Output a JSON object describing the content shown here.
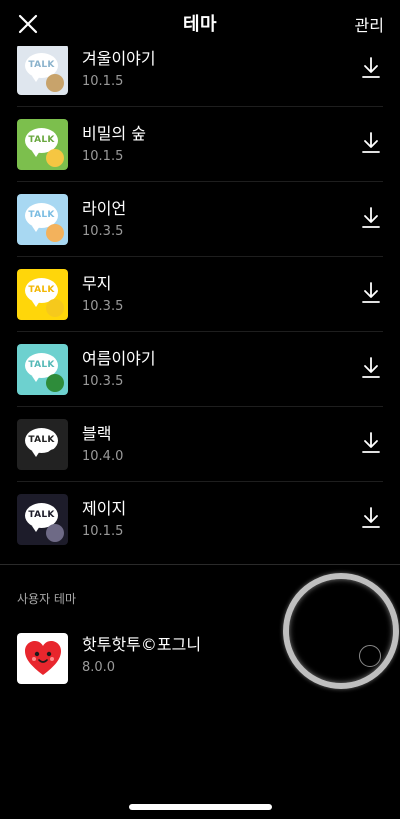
{
  "header": {
    "title": "테마",
    "manage_label": "관리",
    "close_icon": "close-icon"
  },
  "themes": [
    {
      "name": "겨울이야기",
      "version": "10.1.5",
      "thumb_bg": "#dfe6ee",
      "bubble_text": "TALK",
      "bubble_text_color": "#8bb3cc",
      "deco_color": "#c8a36b"
    },
    {
      "name": "비밀의 숲",
      "version": "10.1.5",
      "thumb_bg": "#7cbf4d",
      "bubble_text": "TALK",
      "bubble_text_color": "#6aa83f",
      "deco_color": "#f5c642"
    },
    {
      "name": "라이언",
      "version": "10.3.5",
      "thumb_bg": "#a8d8f2",
      "bubble_text": "TALK",
      "bubble_text_color": "#7cbde2",
      "deco_color": "#f3b25c"
    },
    {
      "name": "무지",
      "version": "10.3.5",
      "thumb_bg": "#ffd60a",
      "bubble_text": "TALK",
      "bubble_text_color": "#f2b705",
      "deco_color": "#f6c91c"
    },
    {
      "name": "여름이야기",
      "version": "10.3.5",
      "thumb_bg": "#6dd1cf",
      "bubble_text": "TALK",
      "bubble_text_color": "#55b9b7",
      "deco_color": "#2e8c3a"
    },
    {
      "name": "블랙",
      "version": "10.4.0",
      "thumb_bg": "#222222",
      "bubble_text": "TALK",
      "bubble_text_color": "#222222",
      "deco_color": "#222222"
    },
    {
      "name": "제이지",
      "version": "10.1.5",
      "thumb_bg": "#1d1c2a",
      "bubble_text": "TALK",
      "bubble_text_color": "#1d1c2a",
      "deco_color": "#6e6a86"
    }
  ],
  "user_section": {
    "title": "사용자 테마",
    "theme": {
      "name": "핫투핫투©포그니",
      "version": "8.0.0",
      "heart_color": "#e8262d"
    }
  },
  "colors": {
    "background": "#000000",
    "text": "#ffffff",
    "secondary_text": "#9a9a9a"
  }
}
